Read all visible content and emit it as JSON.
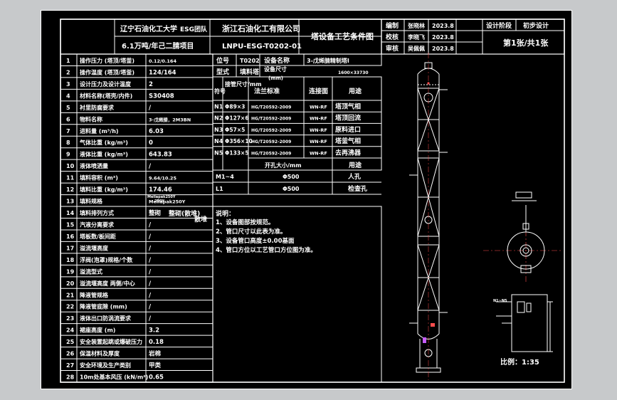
{
  "title_block": {
    "university": "辽宁石油化工大学",
    "team": "ESG团队",
    "company": "浙江石油化工有限公司",
    "project": "6.1万吨/年己二腈项目",
    "drawing_no": "LNPU-ESG-T0202-01",
    "drawing_title": "塔设备工艺条件图",
    "roles": [
      {
        "role": "编制",
        "name": "张晓林",
        "date": "2023.8"
      },
      {
        "role": "校核",
        "name": "李晓飞",
        "date": "2023.8"
      },
      {
        "role": "审核",
        "name": "吴佩佩",
        "date": "2023.8"
      }
    ],
    "stage_label": "设计阶段",
    "stage_value": "初步设计",
    "sheet_info": "第1张/共1张"
  },
  "params": [
    {
      "no": "1",
      "name": "操作压力 (塔顶/塔釜)",
      "value": "0.12/0.164"
    },
    {
      "no": "2",
      "name": "操作温度 (塔顶/塔釜)",
      "value": "124/164"
    },
    {
      "no": "3",
      "name": "设计压力及设计温度",
      "value": "2"
    },
    {
      "no": "4",
      "name": "材料名称(塔壳/内件)",
      "value": "S30408"
    },
    {
      "no": "5",
      "name": "衬里防腐要求",
      "value": "/"
    },
    {
      "no": "6",
      "name": "物料名称",
      "value": "3-戊烯腈，2M3BN"
    },
    {
      "no": "7",
      "name": "进料量 (m³/h)",
      "value": "6.03"
    },
    {
      "no": "8",
      "name": "气体比重 (kg/m³)",
      "value": "0"
    },
    {
      "no": "9",
      "name": "液体比重 (kg/m³)",
      "value": "643.83"
    },
    {
      "no": "10",
      "name": "液体喷洒量",
      "value": "/"
    },
    {
      "no": "11",
      "name": "填料容积 (m³)",
      "value": "9.64/10.25"
    },
    {
      "no": "12",
      "name": "填料比重 (kg/m³)",
      "value": "174.46"
    },
    {
      "no": "13",
      "name": "填料规格",
      "value": "Mellapak250Y"
    },
    {
      "no": "14",
      "name": "填料排列方式",
      "value": "整砌"
    },
    {
      "no": "15",
      "name": "汽液分离要求",
      "value": "/"
    },
    {
      "no": "16",
      "name": "塔板数/板间距",
      "value": "/"
    },
    {
      "no": "17",
      "name": "溢流堰高度",
      "value": "/"
    },
    {
      "no": "18",
      "name": "浮阀(泡罩)规格/个数",
      "value": "/"
    },
    {
      "no": "19",
      "name": "溢流型式",
      "value": "/"
    },
    {
      "no": "20",
      "name": "溢流堰高度 两侧/中心",
      "value": "/"
    },
    {
      "no": "21",
      "name": "降液管规格",
      "value": "/"
    },
    {
      "no": "22",
      "name": "降液管底隙 (mm)",
      "value": "/"
    },
    {
      "no": "23",
      "name": "液体出口防涡流要求",
      "value": "/"
    },
    {
      "no": "24",
      "name": "裙座高度 (m)",
      "value": "3.2"
    },
    {
      "no": "25",
      "name": "安全装置起跳或爆破压力",
      "value": "0.18"
    },
    {
      "no": "26",
      "name": "保温材料及厚度",
      "value": "岩棉"
    },
    {
      "no": "27",
      "name": "安全环境及生产类别",
      "value": "甲类"
    },
    {
      "no": "28",
      "name": "10m处基本风压 (kN/m²)",
      "value": "0.65"
    }
  ],
  "equipment": {
    "tag_label": "位号",
    "tag": "T0202",
    "name_label": "设备名称",
    "name": "3-戊烯腈精制塔Ⅰ",
    "type_label": "型式",
    "type": "填料塔",
    "size_label": "设备尺寸",
    "size": "1600×33730",
    "unit": "(mm)"
  },
  "nozzle_headers": {
    "symbol": "符号",
    "size": "接管尺寸/mm",
    "standard": "法兰标准",
    "face": "连接面",
    "use": "用途"
  },
  "nozzles": [
    {
      "symbol": "N1",
      "size": "Φ89×3",
      "standard": "HG/T20592-2009",
      "face": "WN-RF",
      "use": "塔顶气相"
    },
    {
      "symbol": "N2",
      "size": "Φ127×6",
      "standard": "HG/T20592-2009",
      "face": "WN-RF",
      "use": "塔顶回流"
    },
    {
      "symbol": "N3",
      "size": "Φ57×5",
      "standard": "HG/T20592-2009",
      "face": "WN-RF",
      "use": "原料进口"
    },
    {
      "symbol": "N4",
      "size": "Φ356×10",
      "standard": "HG/T20592-2009",
      "face": "WN-RF",
      "use": "塔釜气相"
    },
    {
      "symbol": "N5",
      "size": "Φ133×5",
      "standard": "HG/T20592-2009",
      "face": "WN-RF",
      "use": "去再沸器"
    }
  ],
  "manholes": {
    "header_size": "开孔大小/mm",
    "header_use": "用途",
    "rows": [
      {
        "symbol": "M1~4",
        "size": "Φ500",
        "use": "人孔"
      },
      {
        "symbol": "L1",
        "size": "Φ500",
        "use": "检查孔"
      }
    ]
  },
  "notes": {
    "title": "说明：",
    "lines": [
      "1、设备图部按规范。",
      "2、管口尺寸以此表为准。",
      "3、设备管口高度±0.00基面",
      "4、管口方位以工艺管口方位图为准。"
    ]
  },
  "overlay_labels": {
    "r13_top": "Mellapak250Y",
    "r13_bot": "250Y",
    "r14_a": "整砌",
    "r14_b": "(散堆)",
    "r14_c": "散堆"
  },
  "detail_label": "N1~N5",
  "scale": "比例：1:35"
}
